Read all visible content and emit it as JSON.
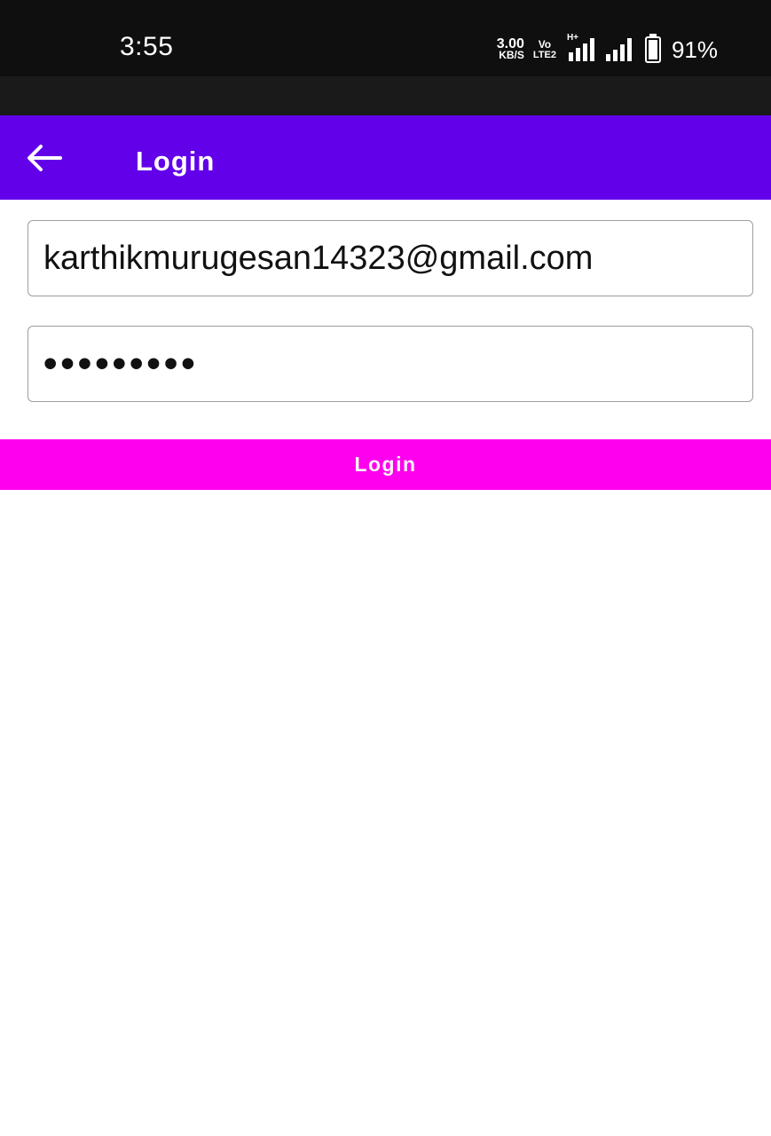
{
  "status_bar": {
    "time": "3:55",
    "net_speed_value": "3.00",
    "net_speed_unit": "KB/S",
    "volte_top": "Vo",
    "volte_bottom": "LTE2",
    "network_type": "H+",
    "battery_text": "91%",
    "battery_level": 0.91
  },
  "app_bar": {
    "back_icon": "arrow-left-icon",
    "title": "Login",
    "color": "#6200ea"
  },
  "form": {
    "email_value": "karthikmurugesan14323@gmail.com",
    "password_masked": "•••••••••"
  },
  "login_button": {
    "label": "Login",
    "color": "#ff00ee"
  }
}
